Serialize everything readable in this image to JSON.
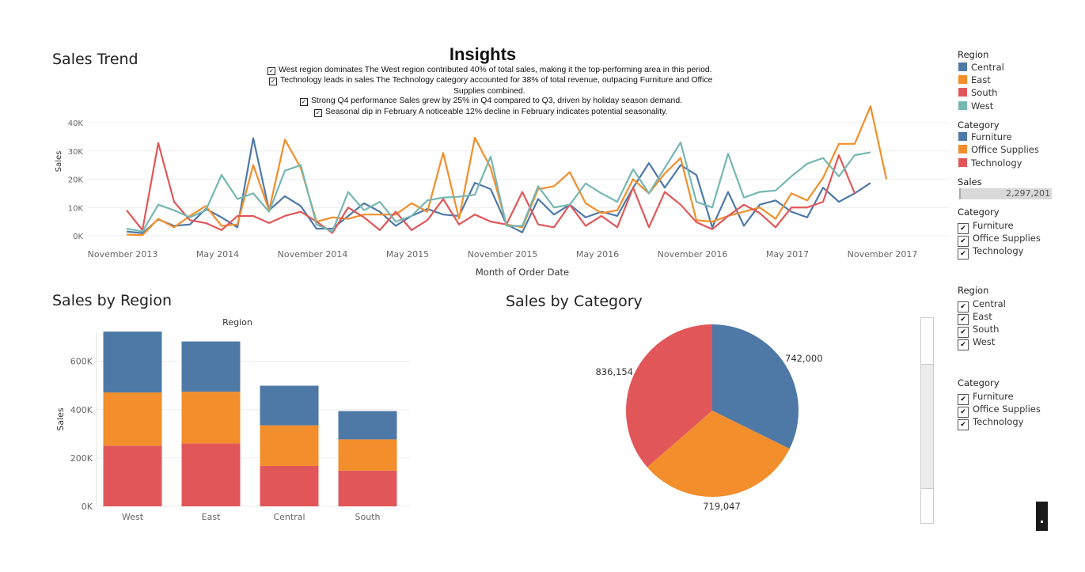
{
  "insights": {
    "title": "Insights",
    "items": [
      "West region dominates The West region contributed 40% of total sales, making it the top-performing area in this period.",
      "Technology leads in sales The Technology category accounted for 38% of total revenue, outpacing Furniture and Office",
      "Supplies combined.",
      "Strong Q4 performance Sales grew by 25% in Q4 compared to Q3, driven by holiday season demand.",
      "Seasonal dip in February A noticeable 12% decline in February indicates potential seasonality."
    ]
  },
  "colors": {
    "blue": "#4e79a7",
    "orange": "#f28e2b",
    "red": "#e15759",
    "teal": "#76b7b2"
  },
  "legend_region": {
    "title": "Region",
    "items": [
      {
        "label": "Central",
        "color": "#4e79a7"
      },
      {
        "label": "East",
        "color": "#f28e2b"
      },
      {
        "label": "South",
        "color": "#e15759"
      },
      {
        "label": "West",
        "color": "#76b7b2"
      }
    ]
  },
  "legend_category": {
    "title": "Category",
    "items": [
      {
        "label": "Furniture",
        "color": "#4e79a7"
      },
      {
        "label": "Office Supplies",
        "color": "#f28e2b"
      },
      {
        "label": "Technology",
        "color": "#e15759"
      }
    ]
  },
  "sales_filter": {
    "title": "Sales",
    "value": "2,297,201"
  },
  "filter_category_1": {
    "title": "Category",
    "items": [
      "Furniture",
      "Office Supplies",
      "Technology"
    ]
  },
  "filter_region": {
    "title": "Region",
    "items": [
      "Central",
      "East",
      "South",
      "West"
    ]
  },
  "filter_category_2": {
    "title": "Category",
    "items": [
      "Furniture",
      "Office Supplies",
      "Technology"
    ]
  },
  "chart_data": [
    {
      "type": "line",
      "title": "Sales Trend",
      "xlabel": "Month of Order Date",
      "ylabel": "Sales",
      "x_tick_labels": [
        "November 2013",
        "May 2014",
        "November 2014",
        "May 2015",
        "November 2015",
        "May 2016",
        "November 2016",
        "May 2017",
        "November 2017"
      ],
      "y_tick_labels": [
        "0K",
        "10K",
        "20K",
        "30K",
        "40K"
      ],
      "ylim": [
        0,
        47000
      ],
      "x_start": "2013-11",
      "series": [
        {
          "name": "Central",
          "color": "#4e79a7",
          "values": [
            1500,
            900,
            5800,
            3500,
            4000,
            9500,
            6500,
            3000,
            34500,
            9000,
            14000,
            10500,
            2500,
            2500,
            7000,
            11500,
            8500,
            3500,
            7000,
            9500,
            7500,
            7000,
            18700,
            16500,
            4000,
            1200,
            13000,
            7500,
            11000,
            6500,
            8500,
            7000,
            17000,
            25700,
            17000,
            25000,
            21500,
            3000,
            15500,
            3500,
            11000,
            12500,
            8500,
            6500,
            17000,
            12000,
            15000,
            18700
          ]
        },
        {
          "name": "East",
          "color": "#f28e2b",
          "values": [
            400,
            200,
            6000,
            3000,
            7000,
            10500,
            3500,
            4000,
            25000,
            9000,
            34000,
            24000,
            5000,
            6500,
            6000,
            7500,
            7500,
            7500,
            11500,
            8500,
            29300,
            6000,
            34700,
            24000,
            4000,
            3000,
            16500,
            17500,
            22500,
            11500,
            8000,
            9000,
            20000,
            15000,
            22000,
            27500,
            5500,
            5000,
            7000,
            8500,
            10000,
            6000,
            15000,
            12500,
            20500,
            32500,
            32500,
            45800,
            20000
          ]
        },
        {
          "name": "South",
          "color": "#e15759",
          "values": [
            9000,
            2000,
            32800,
            12000,
            5500,
            4500,
            2000,
            7000,
            7000,
            4500,
            7000,
            8500,
            5000,
            1000,
            10000,
            6500,
            2000,
            8500,
            2000,
            5500,
            13000,
            4000,
            7500,
            5000,
            4000,
            15500,
            4000,
            3000,
            11000,
            3500,
            7000,
            3000,
            17000,
            3000,
            15500,
            11000,
            4800,
            2300,
            7000,
            11000,
            8000,
            3000,
            10000,
            10000,
            12000,
            28500,
            15000
          ]
        },
        {
          "name": "West",
          "color": "#76b7b2",
          "values": [
            2500,
            1500,
            11000,
            9000,
            6500,
            9000,
            21500,
            13000,
            15000,
            8500,
            23000,
            25000,
            4000,
            1500,
            15500,
            9000,
            12000,
            5000,
            7000,
            12500,
            13500,
            13800,
            14500,
            28000,
            3500,
            3500,
            17500,
            10000,
            11000,
            18500,
            15000,
            12000,
            23500,
            15000,
            24000,
            33000,
            12000,
            10000,
            29000,
            13500,
            15500,
            16000,
            21000,
            25500,
            27500,
            21000,
            28500,
            29500
          ]
        }
      ]
    },
    {
      "type": "bar",
      "title": "Sales by Region",
      "xlabel": "Region",
      "ylabel": "Sales",
      "categories": [
        "West",
        "East",
        "Central",
        "South"
      ],
      "y_tick_labels": [
        "0K",
        "200K",
        "400K",
        "600K"
      ],
      "ylim": [
        0,
        720000
      ],
      "stacked": true,
      "series": [
        {
          "name": "Technology",
          "color": "#e15759",
          "values": [
            251000,
            260000,
            167000,
            148000
          ]
        },
        {
          "name": "Office Supplies",
          "color": "#f28e2b",
          "values": [
            220000,
            214000,
            168000,
            129000
          ]
        },
        {
          "name": "Furniture",
          "color": "#4e79a7",
          "values": [
            252000,
            208000,
            164000,
            117000
          ]
        }
      ]
    },
    {
      "type": "pie",
      "title": "Sales by Category",
      "slices": [
        {
          "name": "Furniture",
          "value": 742000,
          "label": "742,000",
          "color": "#4e79a7"
        },
        {
          "name": "Office Supplies",
          "value": 719047,
          "label": "719,047",
          "color": "#f28e2b"
        },
        {
          "name": "Technology",
          "value": 836154,
          "label": "836,154",
          "color": "#e15759"
        }
      ]
    }
  ]
}
